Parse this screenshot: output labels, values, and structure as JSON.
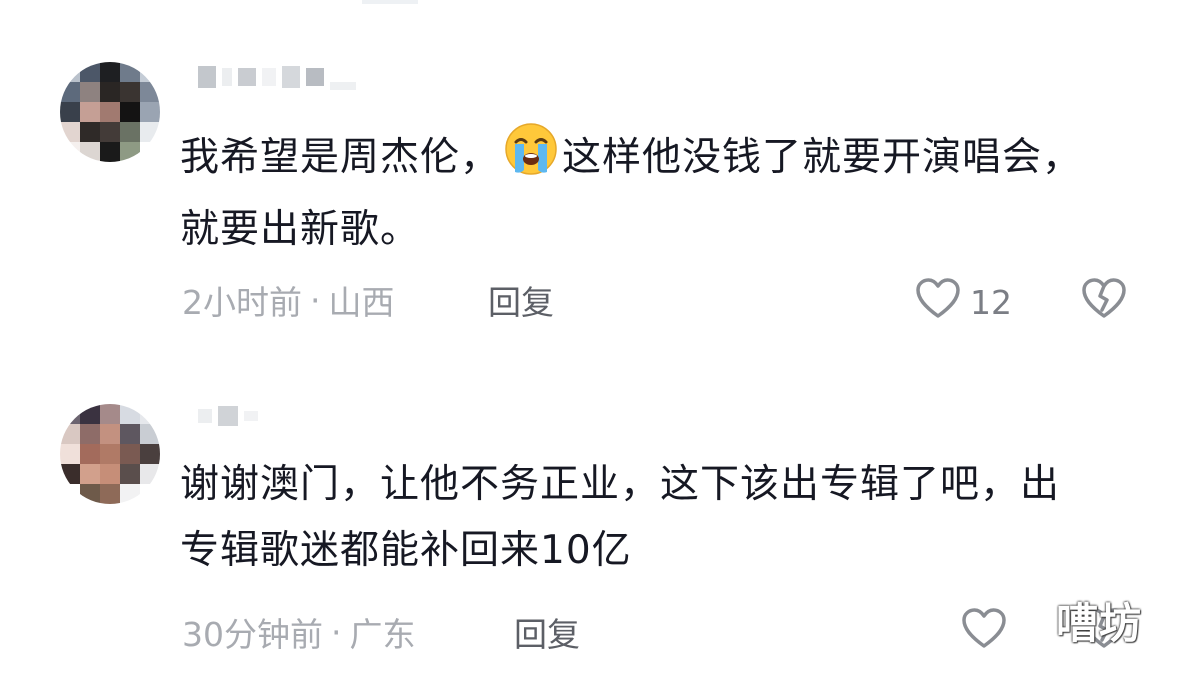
{
  "comments": [
    {
      "text_before_emoji": "我希望是周杰伦，",
      "emoji": "loudly-crying-face",
      "text_after_emoji": "这样他没钱了就要开演唱会，就要出新歌。",
      "time": "2小时前",
      "separator": "·",
      "location": "山西",
      "reply_label": "回复",
      "like_count": "12"
    },
    {
      "text": "谢谢澳门，让他不务正业，这下该出专辑了吧，出专辑歌迷都能补回来10亿",
      "time": "30分钟前",
      "separator": "·",
      "location": "广东",
      "reply_label": "回复"
    }
  ],
  "icons": {
    "like": "heart-outline-icon",
    "dislike": "broken-heart-icon"
  },
  "colors": {
    "text": "#161823",
    "meta": "#a8abb1",
    "reply": "#5c5f66",
    "icon": "#8a8d93"
  },
  "watermark": "嘈坊"
}
